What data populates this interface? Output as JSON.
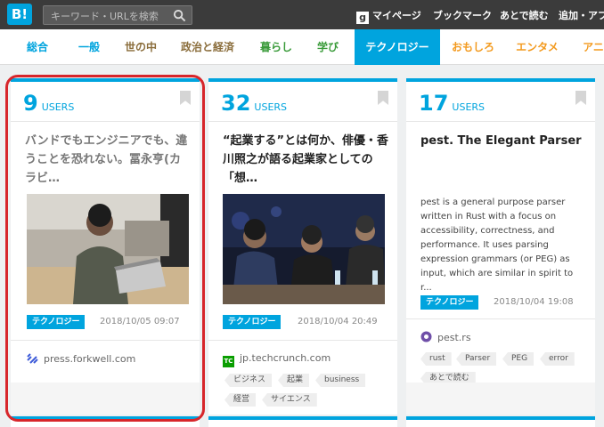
{
  "header": {
    "logo": "B!",
    "search_placeholder": "キーワード・URLを検索",
    "links": [
      "マイページ",
      "ブックマーク",
      "あとで読む",
      "追加・アプ"
    ],
    "mypage_icon_glyph": "g"
  },
  "categories": {
    "active_color": "#00a4de",
    "items": [
      {
        "label": "総合",
        "color": "#00a4de"
      },
      {
        "label": "一般",
        "color": "#00a4de"
      },
      {
        "label": "世の中",
        "color": "#8a6d3b"
      },
      {
        "label": "政治と経済",
        "color": "#8a6d3b"
      },
      {
        "label": "暮らし",
        "color": "#3a9b3a"
      },
      {
        "label": "学び",
        "color": "#3a9b3a"
      },
      {
        "label": "テクノロジー",
        "color": "#ffffff"
      },
      {
        "label": "おもしろ",
        "color": "#f39a1e"
      },
      {
        "label": "エンタメ",
        "color": "#f39a1e"
      },
      {
        "label": "アニ",
        "color": "#f39a1e"
      }
    ]
  },
  "cards": [
    {
      "users_count": "9",
      "users_label": "USERS",
      "title": "バンドでもエンジニアでも、違うことを恐れない。冨永亨(カラビ…",
      "category_tag": "テクノロジー",
      "date": "2018/10/05 09:07",
      "source": "press.forkwell.com"
    },
    {
      "users_count": "32",
      "users_label": "USERS",
      "title": "“起業する”とは何か、俳優・香川照之が語る起業家としての「想…",
      "category_tag": "テクノロジー",
      "date": "2018/10/04 20:49",
      "source": "jp.techcrunch.com",
      "source_icon_text": "TC",
      "tags": [
        "ビジネス",
        "起業",
        "business",
        "経営",
        "サイエンス"
      ]
    },
    {
      "users_count": "17",
      "users_label": "USERS",
      "title": "pest. The Elegant Parser",
      "description": "pest is a general purpose parser written in Rust with a focus on accessibility, correctness, and performance. It uses parsing expression grammars (or PEG) as input, which are similar in spirit to r...",
      "category_tag": "テクノロジー",
      "date": "2018/10/04 19:08",
      "source": "pest.rs",
      "tags": [
        "rust",
        "Parser",
        "PEG",
        "error",
        "あとで読む"
      ]
    }
  ]
}
